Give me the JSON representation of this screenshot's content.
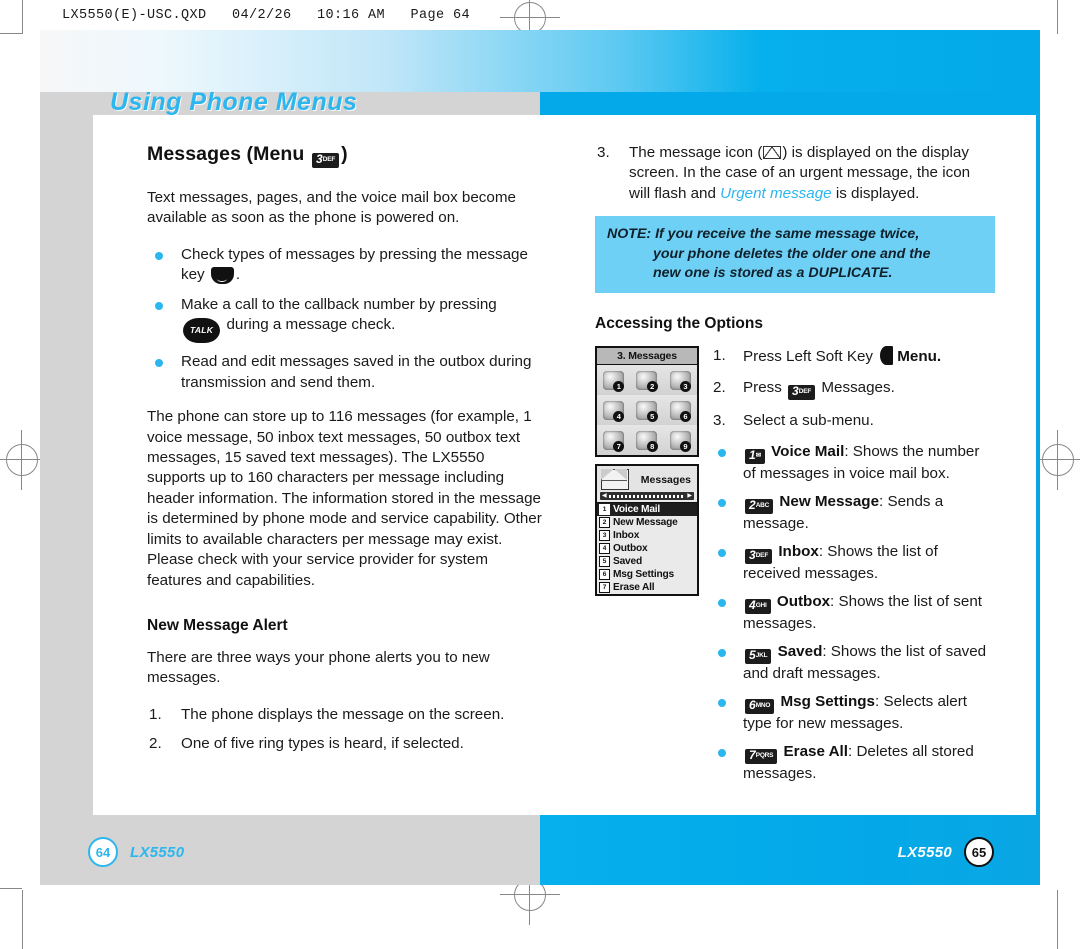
{
  "print_slug": "LX5550(E)-USC.QXD   04/2/26   10:16 AM   Page 64",
  "chapter_title": "Using Phone Menus",
  "colors": {
    "accent_cyan": "#2cb6ef",
    "page_right_bg": "#03a9e8",
    "note_bg": "#6fd0f5",
    "paper_grey": "#d4d4d4"
  },
  "left_page": {
    "section_title_pre": "Messages (Menu ",
    "section_title_post": ")",
    "section_key": {
      "num": "3",
      "letters": "DEF"
    },
    "intro": "Text messages, pages, and the voice mail box become available as soon as the phone is powered on.",
    "bullets": [
      {
        "pre": "Check types of messages by pressing the message key ",
        "icon": "message-key-icon",
        "post": "."
      },
      {
        "pre": "Make a call to the callback number by pressing ",
        "icon": "talk-key-icon",
        "icon_label": "TALK",
        "post": " during a message check."
      },
      {
        "pre": "Read and edit messages saved in the outbox during transmission and send them.",
        "icon": "",
        "post": ""
      }
    ],
    "capacity_paragraph": "The phone can store up to 116 messages (for example, 1 voice message, 50 inbox text messages, 50 outbox text messages, 15 saved text messages). The LX5550 supports up to 160 characters per message including header information. The information stored in the message is determined by phone mode and service capability. Other limits to available characters per message may exist. Please check with your service provider for system features and capabilities.",
    "alert_heading": "New Message Alert",
    "alert_intro": "There are three ways your phone alerts you to new messages.",
    "alert_steps": [
      {
        "num": "1.",
        "text": "The phone displays the message on the screen."
      },
      {
        "num": "2.",
        "text": "One of five ring types is heard, if selected."
      }
    ],
    "footer": {
      "page": "64",
      "model": "LX5550"
    }
  },
  "right_page": {
    "step3": {
      "num": "3.",
      "pre": "The message icon (",
      "icon": "envelope-icon",
      "mid": ") is displayed on the display screen. In the case of an urgent message, the icon will flash and ",
      "emphasis": "Urgent message",
      "post": " is displayed."
    },
    "note": {
      "line1": "NOTE: If you receive the same message twice,",
      "line2": "your phone deletes the older one and the",
      "line3": "new one is stored as a DUPLICATE."
    },
    "options_heading": "Accessing the Options",
    "lcd_menu": {
      "title": "3. Messages",
      "cells": [
        {
          "badge": "1"
        },
        {
          "badge": "2"
        },
        {
          "badge": "3"
        },
        {
          "badge": "4"
        },
        {
          "badge": "5"
        },
        {
          "badge": "6"
        },
        {
          "badge": "7"
        },
        {
          "badge": "8"
        },
        {
          "badge": "9"
        }
      ]
    },
    "lcd_list": {
      "title": "Messages",
      "items": [
        {
          "num": "1",
          "label": "Voice Mail",
          "selected": true
        },
        {
          "num": "2",
          "label": "New Message",
          "selected": false
        },
        {
          "num": "3",
          "label": "Inbox",
          "selected": false
        },
        {
          "num": "4",
          "label": "Outbox",
          "selected": false
        },
        {
          "num": "5",
          "label": "Saved",
          "selected": false
        },
        {
          "num": "6",
          "label": "Msg Settings",
          "selected": false
        },
        {
          "num": "7",
          "label": "Erase All",
          "selected": false
        }
      ]
    },
    "steps": [
      {
        "num": "1.",
        "pre": "Press Left Soft Key ",
        "icon": "left-soft-key-icon",
        "post": "Menu."
      },
      {
        "num": "2.",
        "pre": "Press ",
        "key": {
          "num": "3",
          "letters": "DEF"
        },
        "post": "Messages."
      },
      {
        "num": "3.",
        "pre": "Select a sub-menu.",
        "post": ""
      }
    ],
    "options": [
      {
        "key": {
          "num": "1",
          "letters": "✉"
        },
        "label": "Voice Mail",
        "desc": ": Shows the number of messages in voice mail box."
      },
      {
        "key": {
          "num": "2",
          "letters": "ABC"
        },
        "label": "New Message",
        "desc": ": Sends a message."
      },
      {
        "key": {
          "num": "3",
          "letters": "DEF"
        },
        "label": "Inbox",
        "desc": ": Shows the list of received messages."
      },
      {
        "key": {
          "num": "4",
          "letters": "GHI"
        },
        "label": "Outbox",
        "desc": ": Shows the list of sent messages."
      },
      {
        "key": {
          "num": "5",
          "letters": "JKL"
        },
        "label": "Saved",
        "desc": ": Shows the list of saved and draft messages."
      },
      {
        "key": {
          "num": "6",
          "letters": "MNO"
        },
        "label": "Msg Settings",
        "desc": ": Selects alert type for new messages."
      },
      {
        "key": {
          "num": "7",
          "letters": "PQRS"
        },
        "label": "Erase All",
        "desc": ": Deletes all stored messages."
      }
    ],
    "footer": {
      "page": "65",
      "model": "LX5550"
    }
  }
}
